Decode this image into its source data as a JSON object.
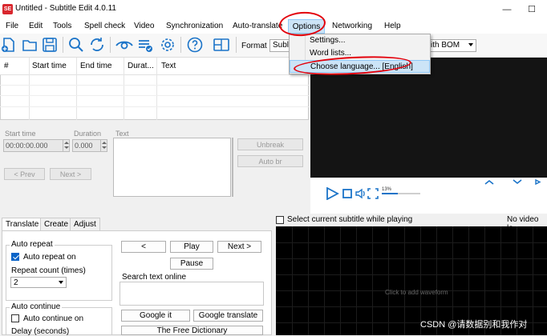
{
  "window": {
    "title": "Untitled - Subtitle Edit 4.0.11",
    "app_icon_text": "SE",
    "minimize": "—",
    "maximize": "☐"
  },
  "menu": {
    "items": [
      "File",
      "Edit",
      "Tools",
      "Spell check",
      "Video",
      "Synchronization",
      "Auto-translate",
      "Options",
      "Networking",
      "Help"
    ]
  },
  "toolbar": {
    "format_label": "Format",
    "format_value": "Subl",
    "encoding_value": "ith BOM"
  },
  "options_menu": {
    "items": [
      "Settings...",
      "Word lists...",
      "Choose language... [English]"
    ]
  },
  "grid": {
    "columns": [
      "#",
      "Start time",
      "End time",
      "Durat...",
      "Text"
    ]
  },
  "edit": {
    "start_time_label": "Start time",
    "duration_label": "Duration",
    "text_label": "Text",
    "start_time_value": "00:00:00.000",
    "duration_value": "0.000",
    "prev_button": "< Prev",
    "next_button": "Next >",
    "unbreak_button": "Unbreak",
    "auto_br_button": "Auto br"
  },
  "video": {
    "volume_label": "13%",
    "select_subtitle_label": "Select current subtitle while playing",
    "no_video_label": "No video lo",
    "waveform_hint": "Click to add waveform"
  },
  "tabs": [
    "Translate",
    "Create",
    "Adjust"
  ],
  "translate": {
    "auto_repeat_title": "Auto repeat",
    "auto_repeat_on": "Auto repeat on",
    "repeat_count_label": "Repeat count (times)",
    "repeat_count_value": "2",
    "auto_continue_title": "Auto continue",
    "auto_continue_on": "Auto continue on",
    "delay_label": "Delay (seconds)",
    "prev_btn": "<",
    "play_btn": "Play",
    "next_btn": "Next >",
    "pause_btn": "Pause",
    "search_online_label": "Search text online",
    "google_it": "Google it",
    "google_translate": "Google translate",
    "free_dictionary": "The Free Dictionary"
  },
  "watermark": "CSDN @请数据别和我作对"
}
